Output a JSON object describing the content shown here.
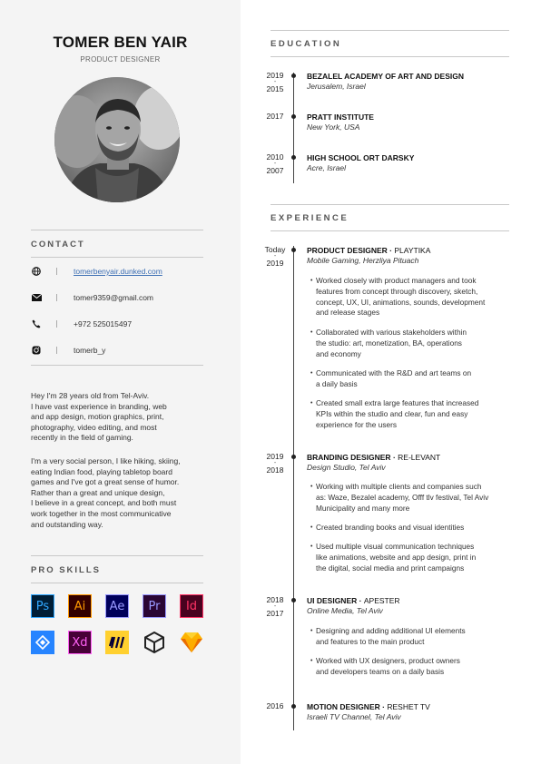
{
  "profile": {
    "name": "TOMER BEN YAIR",
    "role": "PRODUCT DESIGNER"
  },
  "contact": {
    "title": "CONTACT",
    "items": [
      {
        "icon": "globe-icon",
        "text": "tomerbenyair.dunked.com",
        "link": true
      },
      {
        "icon": "envelope-icon",
        "text": "tomer9359@gmail.com",
        "link": false
      },
      {
        "icon": "phone-icon",
        "text": "+972 525015497",
        "link": false
      },
      {
        "icon": "instagram-icon",
        "text": "tomerb_y",
        "link": false
      }
    ]
  },
  "about": {
    "p1": [
      "Hey I'm 28 years old from Tel-Aviv.",
      "I have vast experience in branding, web",
      "and app design, motion graphics, print,",
      "photography, video editing, and most",
      "recently in the field of gaming."
    ],
    "p2": [
      "I'm a very social person, I like hiking, skiing,",
      "eating Indian food, playing tabletop board",
      "games and I've got a great sense of humor.",
      "Rather than a great and unique design,",
      "I believe in a great concept, and both must",
      "work together in the most communicative",
      "and outstanding way."
    ]
  },
  "skills": {
    "title": "PRO SKILLS",
    "items": [
      {
        "label": "Ps",
        "name": "photoshop-icon",
        "color": "#31a8ff",
        "bg": "#001e36"
      },
      {
        "label": "Ai",
        "name": "illustrator-icon",
        "color": "#ff9a00",
        "bg": "#330000"
      },
      {
        "label": "Ae",
        "name": "after-effects-icon",
        "color": "#9999ff",
        "bg": "#00005b"
      },
      {
        "label": "Pr",
        "name": "premiere-icon",
        "color": "#9999ff",
        "bg": "#2a0634"
      },
      {
        "label": "Id",
        "name": "indesign-icon",
        "color": "#ff3366",
        "bg": "#49021f"
      },
      {
        "label": "",
        "name": "jira-icon",
        "color": "#ffffff",
        "bg": "#2684ff"
      },
      {
        "label": "Xd",
        "name": "xd-icon",
        "color": "#ff61f6",
        "bg": "#470137"
      },
      {
        "label": "",
        "name": "miro-icon",
        "color": "#050038",
        "bg": "#ffd02f"
      },
      {
        "label": "",
        "name": "unity-icon",
        "color": "#222222",
        "bg": "transparent"
      },
      {
        "label": "",
        "name": "sketch-icon",
        "color": "#f7b500",
        "bg": "transparent"
      }
    ]
  },
  "education": {
    "title": "EDUCATION",
    "items": [
      {
        "y1": "2019",
        "y2": "2015",
        "school": "BEZALEL ACADEMY OF ART AND DESIGN",
        "place": "Jerusalem, Israel"
      },
      {
        "y1": "2017",
        "y2": "",
        "school": "PRATT INSTITUTE",
        "place": "New York, USA"
      },
      {
        "y1": "2010",
        "y2": "2007",
        "school": "HIGH SCHOOL ORT DARSKY",
        "place": "Acre, Israel"
      }
    ]
  },
  "experience": {
    "title": "EXPERIENCE",
    "items": [
      {
        "y1": "Today",
        "y2": "2019",
        "role": "PRODUCT DESIGNER",
        "company": "PLAYTIKA",
        "place": "Mobile Gaming, Herzliya Pituach",
        "bullets": [
          [
            "Worked closely with product managers and took",
            "features from concept through discovery, sketch,",
            "concept, UX, UI, animations, sounds, development",
            "and release stages"
          ],
          [
            "Collaborated with various stakeholders within",
            "the studio: art, monetization, BA, operations",
            "and economy"
          ],
          [
            "Communicated with the R&D and art teams on",
            "a daily basis"
          ],
          [
            "Created small extra large features that increased",
            "KPIs within the studio and clear, fun and easy",
            "experience for the users"
          ]
        ]
      },
      {
        "y1": "2019",
        "y2": "2018",
        "role": "BRANDING DESIGNER",
        "company": "RE-LEVANT",
        "place": "Design Studio, Tel Aviv",
        "bullets": [
          [
            "Working with multiple clients and companies such",
            "as: Waze, Bezalel academy, Offf tlv festival, Tel Aviv",
            "Municipality and many more"
          ],
          [
            "Created branding books and visual identities"
          ],
          [
            "Used multiple visual communication techniques",
            "like animations, website and app design, print in",
            "the digital, social media and print campaigns"
          ]
        ]
      },
      {
        "y1": "2018",
        "y2": "2017",
        "role": "UI DESIGNER",
        "company": "APESTER",
        "place": "Online Media, Tel Aviv",
        "bullets": [
          [
            "Designing and adding additional UI elements",
            "and features to the main product"
          ],
          [
            "Worked with UX designers, product owners",
            "and developers teams on a daily basis"
          ]
        ]
      },
      {
        "y1": "2016",
        "y2": "",
        "role": "MOTION DESIGNER",
        "company": "RESHET TV",
        "place": "Israeli TV Channel, Tel Aviv",
        "bullets": []
      }
    ]
  },
  "separator": "·"
}
